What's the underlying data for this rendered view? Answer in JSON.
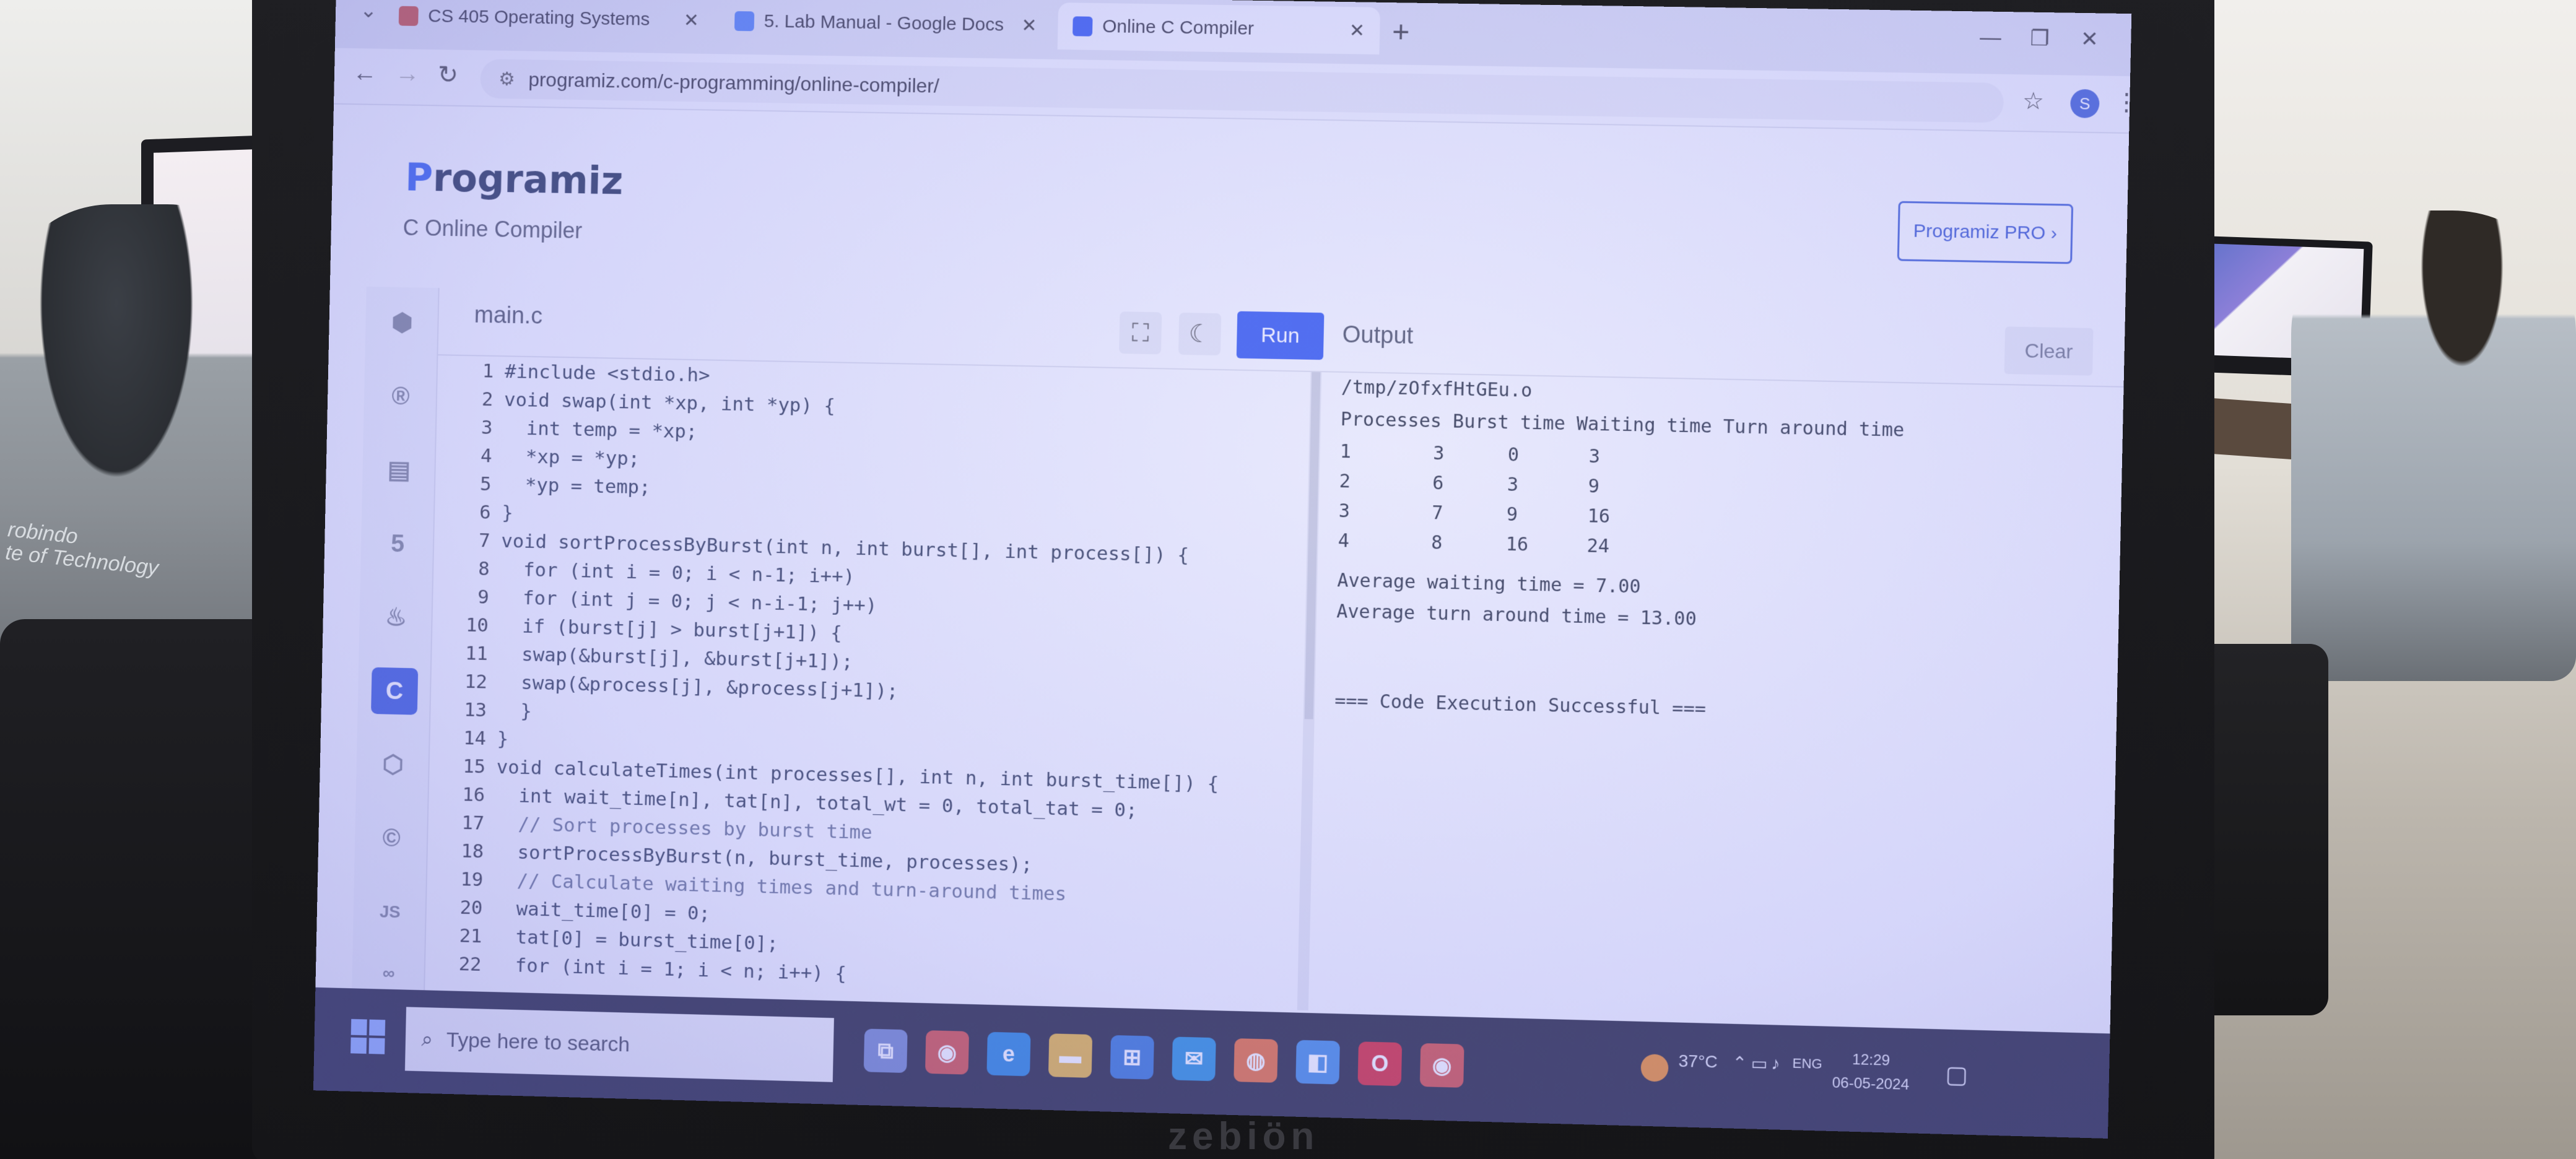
{
  "browser": {
    "tabs": [
      {
        "label": "CS 405 Operating Systems",
        "active": false
      },
      {
        "label": "5. Lab Manual - Google Docs",
        "active": false
      },
      {
        "label": "Online C Compiler",
        "active": true
      }
    ],
    "url": "programiz.com/c-programming/online-compiler/",
    "new_tab_label": "+",
    "profile_initial": "S"
  },
  "site": {
    "logo_text": "rogramiz",
    "logo_mark": "P",
    "subtitle": "C Online Compiler",
    "pro_button": "Programiz PRO ›"
  },
  "editor": {
    "file_name": "main.c",
    "run_label": "Run",
    "lines": [
      {
        "n": "1",
        "text": "#include <stdio.h>"
      },
      {
        "n": "2",
        "text": "void swap(int *xp, int *yp) {"
      },
      {
        "n": "3",
        "text": "  int temp = *xp;"
      },
      {
        "n": "4",
        "text": "  *xp = *yp;"
      },
      {
        "n": "5",
        "text": "  *yp = temp;"
      },
      {
        "n": "6",
        "text": "}"
      },
      {
        "n": "7",
        "text": "void sortProcessByBurst(int n, int burst[], int process[]) {"
      },
      {
        "n": "8",
        "text": "  for (int i = 0; i < n-1; i++)"
      },
      {
        "n": "9",
        "text": "  for (int j = 0; j < n-i-1; j++)"
      },
      {
        "n": "10",
        "text": "  if (burst[j] > burst[j+1]) {"
      },
      {
        "n": "11",
        "text": "  swap(&burst[j], &burst[j+1]);"
      },
      {
        "n": "12",
        "text": "  swap(&process[j], &process[j+1]);"
      },
      {
        "n": "13",
        "text": "  }"
      },
      {
        "n": "14",
        "text": "}"
      },
      {
        "n": "15",
        "text": "void calculateTimes(int processes[], int n, int burst_time[]) {"
      },
      {
        "n": "16",
        "text": "  int wait_time[n], tat[n], total_wt = 0, total_tat = 0;"
      },
      {
        "n": "17",
        "text": "  // Sort processes by burst time"
      },
      {
        "n": "18",
        "text": "  sortProcessByBurst(n, burst_time, processes);"
      },
      {
        "n": "19",
        "text": "  // Calculate waiting times and turn-around times"
      },
      {
        "n": "20",
        "text": "  wait_time[0] = 0;"
      },
      {
        "n": "21",
        "text": "  tat[0] = burst_time[0];"
      },
      {
        "n": "22",
        "text": "  for (int i = 1; i < n; i++) {"
      }
    ]
  },
  "output": {
    "title": "Output",
    "clear_label": "Clear",
    "path": "/tmp/zOfxfHtGEu.o",
    "header": "Processes Burst time Waiting time Turn around time",
    "rows": [
      {
        "p": "1",
        "burst": "3",
        "wait": "0",
        "tat": "3"
      },
      {
        "p": "2",
        "burst": "6",
        "wait": "3",
        "tat": "9"
      },
      {
        "p": "3",
        "burst": "7",
        "wait": "9",
        "tat": "16"
      },
      {
        "p": "4",
        "burst": "8",
        "wait": "16",
        "tat": "24"
      }
    ],
    "avg_wait": "Average waiting time = 7.00",
    "avg_tat": "Average turn around time = 13.00",
    "status": "=== Code Execution Successful ==="
  },
  "taskbar": {
    "search_placeholder": "Type here to search",
    "temperature": "37°C",
    "language": "ENG",
    "time": "12:29",
    "date": "06-05-2024"
  },
  "physical": {
    "monitor_brand": "zebiön",
    "shirt_text_1": "robindo",
    "shirt_text_2": "te of Technology"
  },
  "colors": {
    "run_button": "#2e55ec",
    "active_language": "#3355d8",
    "taskbar": "#1b1c30"
  }
}
